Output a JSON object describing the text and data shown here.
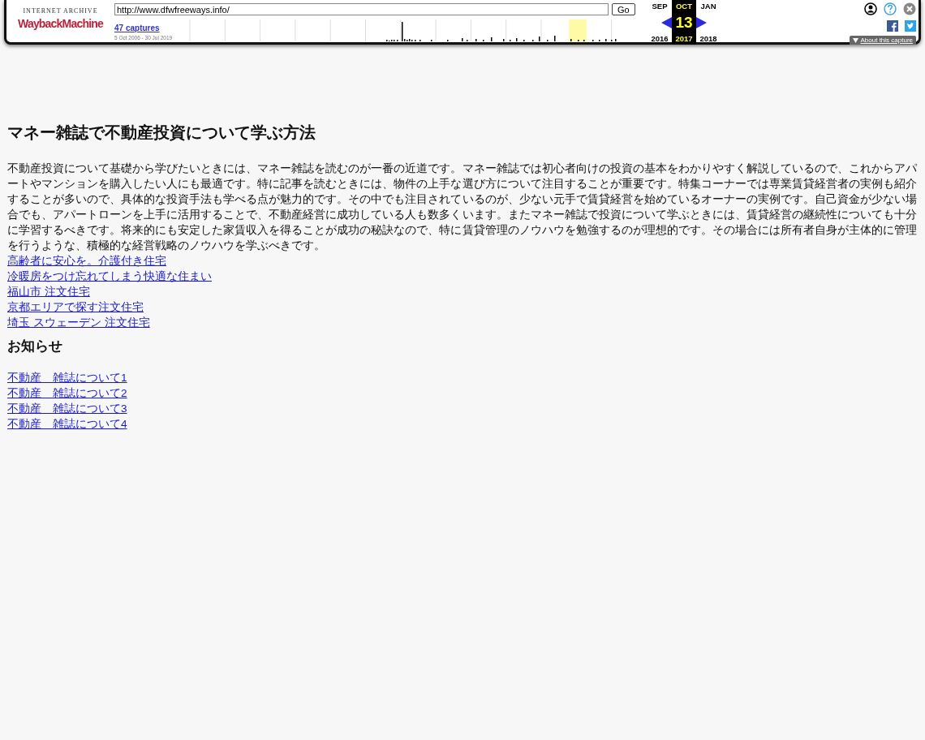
{
  "toolbar": {
    "logo": {
      "top": "INTERNET ARCHIVE",
      "main": "WaybackMachine"
    },
    "url": "http://www.dfwfreeways.info/",
    "go_button": "Go",
    "captures_link": "47 captures",
    "date_range": "5 Oct 2006 - 30 Jul 2019",
    "calendar": [
      {
        "month": "SEP",
        "year": "2016",
        "selected": false
      },
      {
        "month": "OCT",
        "day": "13",
        "year": "2017",
        "selected": true
      },
      {
        "month": "JAN",
        "year": "2018",
        "selected": false
      }
    ],
    "about_link": "About this capture"
  },
  "article": {
    "title": "マネー雑誌で不動産投資について学ぶ方法",
    "paragraph": "不動産投資について基礎から学びたいときには、マネー雑誌を読むのが一番の近道です。マネー雑誌では初心者向けの投資の基本をわかりやすく解説しているので、これからアパートやマンションを購入したい人にも最適です。特に記事を読むときには、物件の上手な選び方について注目することが重要です。特集コーナーでは専業賃貸経営者の実例も紹介することが多いので、具体的な投資手法も学べる点が魅力的です。その中でも注目されているのが、少ない元手で賃貸経営を始めているオーナーの実例です。自己資金が少ない場合でも、アパートローンを上手に活用することで、不動産経営に成功している人も数多くいます。またマネー雑誌で投資について学ぶときには、賃貸経営の継続性についても十分に学習するべきです。将来的にも安定した家賃収入を得ることが成功の秘訣なので、特に賃貸管理のノウハウを勉強するのが理想的です。その場合には所有者自身が主体的に管理を行うような、積極的な経営戦略のノウハウを学ぶべきです。",
    "links": [
      "高齢者に安心を。介護付き住宅",
      "冷暖房をつけ忘れてしまう快適な住まい",
      "福山市 注文住宅",
      "京都エリアで探す注文住宅",
      "埼玉 スウェーデン 注文住宅"
    ],
    "notice_heading": "お知らせ",
    "notice_links": [
      "不動産　雑誌について1",
      "不動産　雑誌について2",
      "不動産　雑誌について3",
      "不動産　雑誌について4"
    ]
  }
}
